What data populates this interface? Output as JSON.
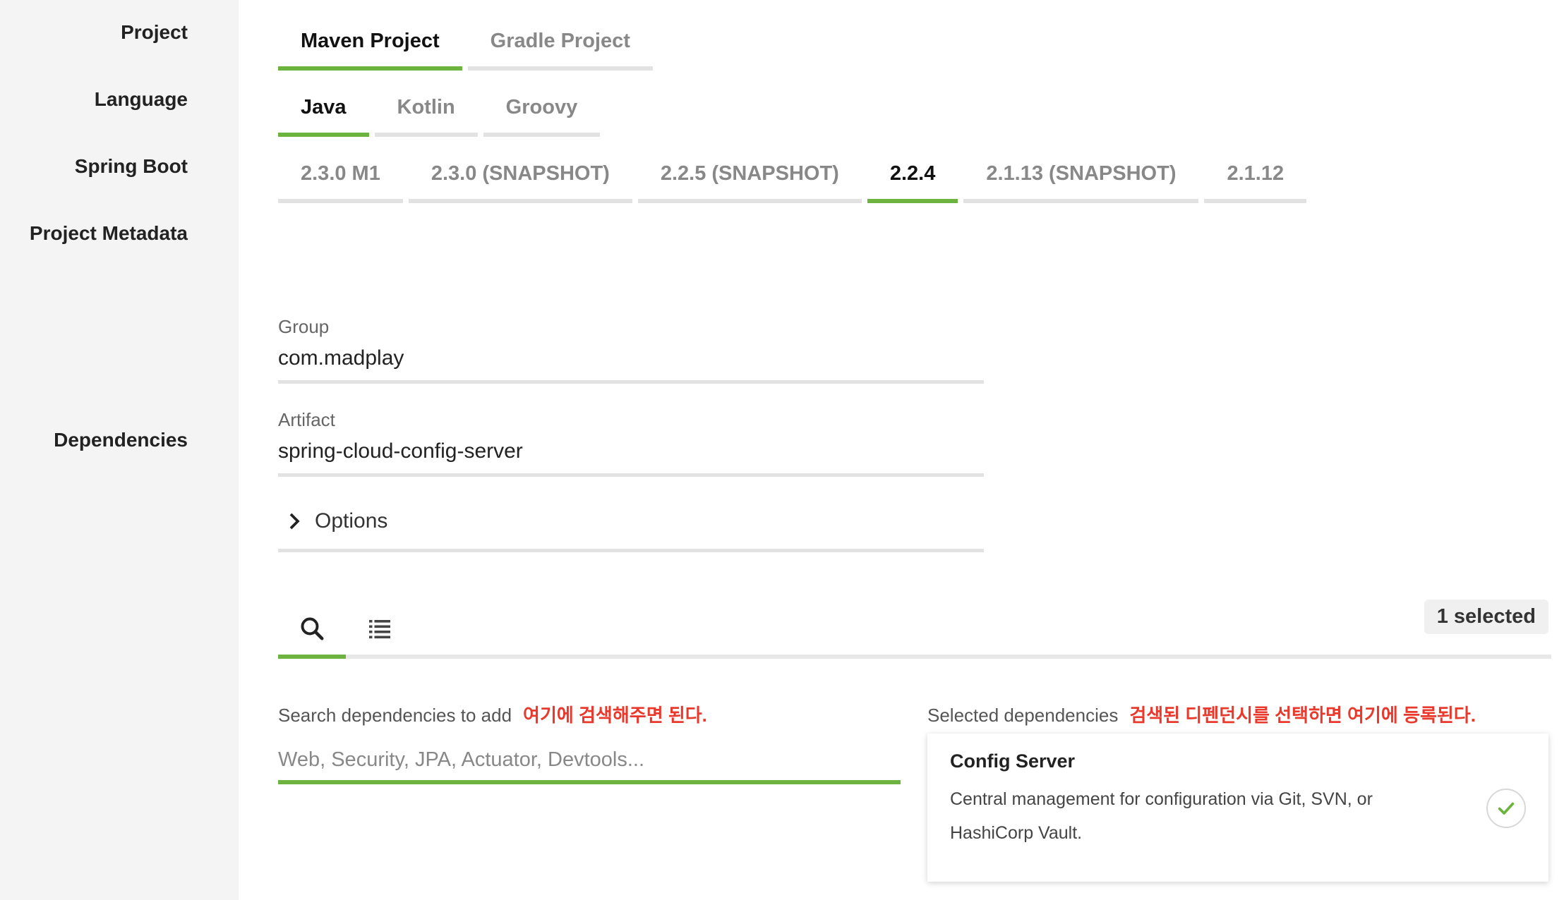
{
  "labels": {
    "project": "Project",
    "language": "Language",
    "spring_boot": "Spring Boot",
    "metadata": "Project Metadata",
    "dependencies": "Dependencies"
  },
  "project_tabs": [
    {
      "label": "Maven Project",
      "active": true
    },
    {
      "label": "Gradle Project",
      "active": false
    }
  ],
  "language_tabs": [
    {
      "label": "Java",
      "active": true
    },
    {
      "label": "Kotlin",
      "active": false
    },
    {
      "label": "Groovy",
      "active": false
    }
  ],
  "boot_tabs": [
    {
      "label": "2.3.0 M1",
      "active": false
    },
    {
      "label": "2.3.0 (SNAPSHOT)",
      "active": false
    },
    {
      "label": "2.2.5 (SNAPSHOT)",
      "active": false
    },
    {
      "label": "2.2.4",
      "active": true
    },
    {
      "label": "2.1.13 (SNAPSHOT)",
      "active": false
    },
    {
      "label": "2.1.12",
      "active": false
    }
  ],
  "metadata": {
    "group_label": "Group",
    "group_value": "com.madplay",
    "artifact_label": "Artifact",
    "artifact_value": "spring-cloud-config-server",
    "options_label": "Options"
  },
  "dependencies": {
    "selected_count": "1 selected",
    "search_label": "Search dependencies to add",
    "search_annotation": "여기에 검색해주면 된다.",
    "search_placeholder": "Web, Security, JPA, Actuator, Devtools...",
    "selected_label": "Selected dependencies",
    "selected_annotation": "검색된 디펜던시를 선택하면 여기에 등록된다.",
    "card": {
      "title": "Config Server",
      "description": "Central management for configuration via Git, SVN, or HashiCorp Vault."
    }
  },
  "colors": {
    "accent": "#6db33f",
    "annotation": "#e8392c"
  },
  "icons": {
    "search": "search-icon",
    "list": "list-icon",
    "chevron": "chevron-right-icon",
    "check": "check-icon"
  }
}
